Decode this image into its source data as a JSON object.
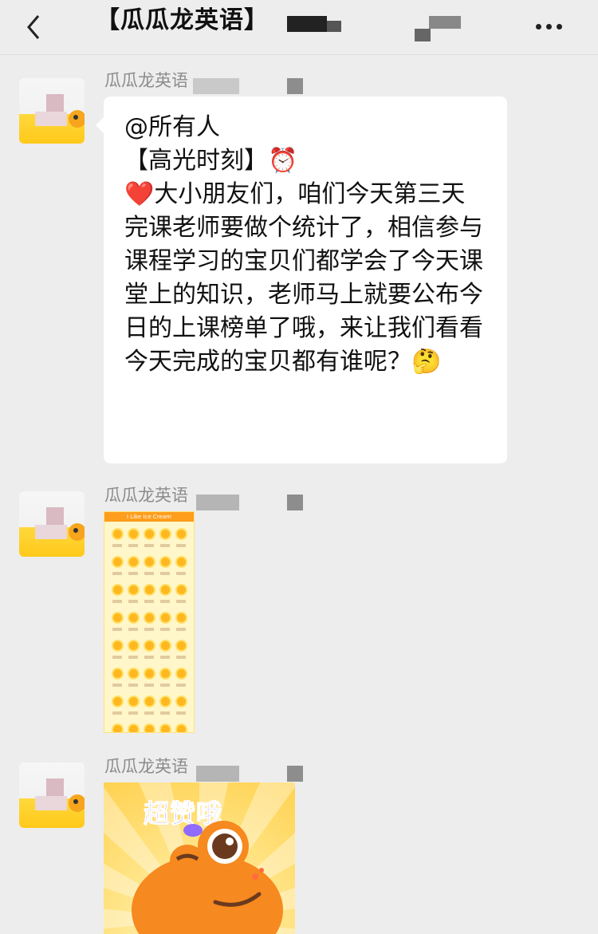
{
  "header": {
    "title": "【瓜瓜龙英语】",
    "back_icon": "chevron-left-icon",
    "more_icon": "more-horizontal-icon"
  },
  "messages": [
    {
      "sender": "瓜瓜龙英语",
      "lines": [
        "@所有人",
        "【高光时刻】⏰",
        "",
        "❤️大小朋友们，咱们今天第三天完课老师要做个统计了，相信参与课程学习的宝贝们都学会了今天课堂上的知识，老师马上就要公布今日的上课榜单了哦，来让我们看看今天完成的宝贝都有谁呢？🤔"
      ]
    },
    {
      "sender": "瓜瓜龙英语",
      "image_title": "I Like Ice Cream"
    },
    {
      "sender": "瓜瓜龙英语",
      "sticker_text": "超赞哦"
    }
  ]
}
